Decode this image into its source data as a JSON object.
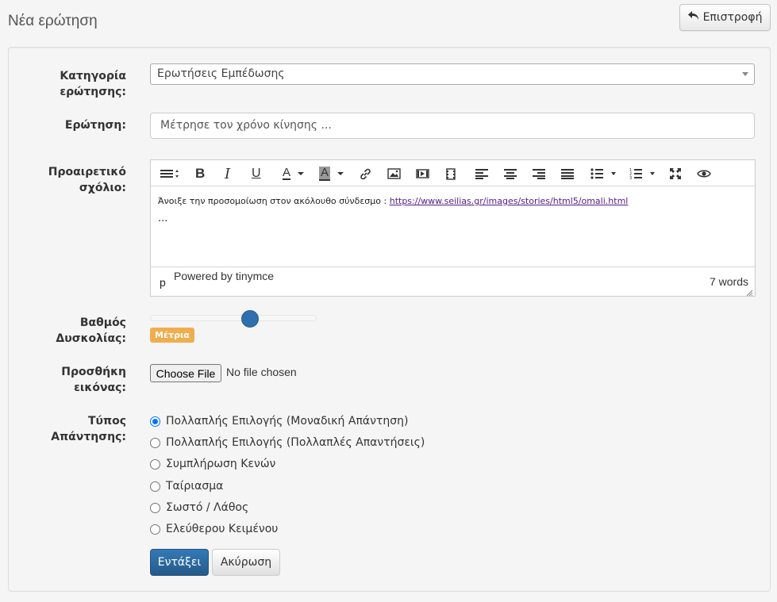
{
  "header": {
    "title": "Νέα ερώτηση",
    "back_label": "Επιστροφή"
  },
  "form": {
    "category": {
      "label_line1": "Κατηγορία",
      "label_line2": "ερώτησης:",
      "value": "Ερωτήσεις Εμπέδωσης"
    },
    "question": {
      "label": "Ερώτηση:",
      "value": "Μέτρησε τον χρόνο κίνησης ..."
    },
    "comment": {
      "label_line1": "Προαιρετικό",
      "label_line2": "σχόλιο:",
      "content_text": "Άνοιξε την προσομοίωση στον ακόλουθο σύνδεσμο : ",
      "content_link": "https://www.seilias.gr/images/stories/html5/omali.html",
      "content_line2": "...",
      "status_path": "p",
      "powered_by": "Powered by tinymce",
      "word_count": "7 words"
    },
    "difficulty": {
      "label_line1": "Βαθμός",
      "label_line2": "Δυσκολίας:",
      "badge": "Μέτρια",
      "badge_color": "#f0ad4e",
      "slider_fraction": 0.6
    },
    "image": {
      "label_line1": "Προσθήκη",
      "label_line2": "εικόνας:",
      "button_label": "Choose File",
      "status": "No file chosen"
    },
    "answer_type": {
      "label_line1": "Τύπος",
      "label_line2": "Απάντησης:",
      "options": [
        "Πολλαπλής Επιλογής (Μοναδική Απάντηση)",
        "Πολλαπλής Επιλογής (Πολλαπλές Απαντήσεις)",
        "Συμπλήρωση Κενών",
        "Ταίριασμα",
        "Σωστό / Λάθος",
        "Ελεύθερου Κειμένου"
      ],
      "selected_index": 0
    },
    "submit_label": "Εντάξει",
    "cancel_label": "Ακύρωση"
  },
  "toolbar_icons": [
    "format-menu-icon",
    "bold-icon",
    "italic-icon",
    "underline-icon",
    "text-color-icon",
    "background-color-icon",
    "link-icon",
    "image-icon",
    "media-icon",
    "video-icon",
    "align-left-icon",
    "align-center-icon",
    "align-right-icon",
    "align-justify-icon",
    "bullet-list-icon",
    "numbered-list-icon",
    "fullscreen-icon",
    "preview-icon"
  ],
  "colors": {
    "primary": "#337ab7",
    "link": "#551a8b",
    "radio_checked": "#0075ff"
  }
}
